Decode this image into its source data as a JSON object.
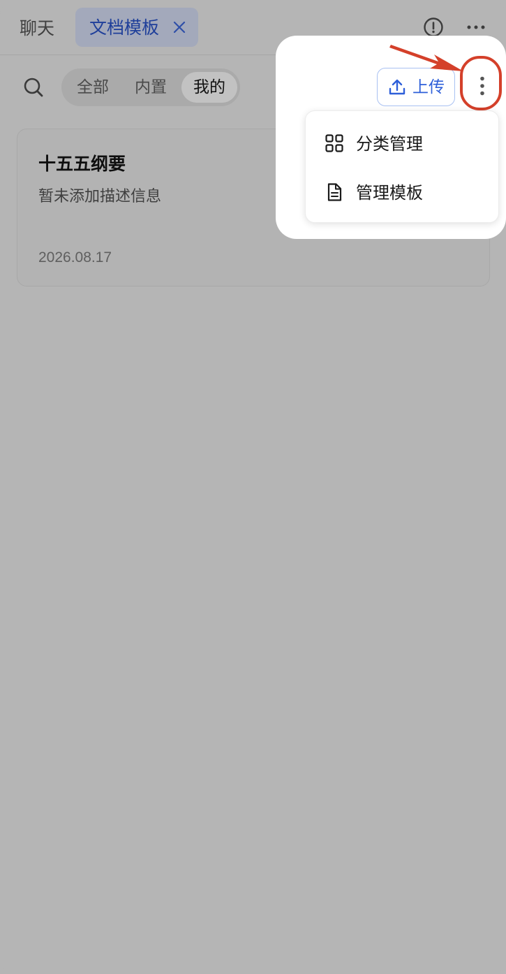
{
  "tabs": {
    "chat_label": "聊天",
    "active_label": "文档模板"
  },
  "filters": {
    "all": "全部",
    "builtin": "内置",
    "mine": "我的",
    "selected": "我的"
  },
  "toolbar": {
    "upload_label": "上传"
  },
  "menu": {
    "items": [
      {
        "label": "分类管理",
        "icon": "grid-icon"
      },
      {
        "label": "管理模板",
        "icon": "document-icon"
      }
    ]
  },
  "templates": [
    {
      "title": "十五五纲要",
      "description": "暂未添加描述信息",
      "date": "2026.08.17"
    }
  ],
  "colors": {
    "accent": "#2e5fd9",
    "annotation": "#d4402a",
    "overlay": "#b5b5b5"
  }
}
